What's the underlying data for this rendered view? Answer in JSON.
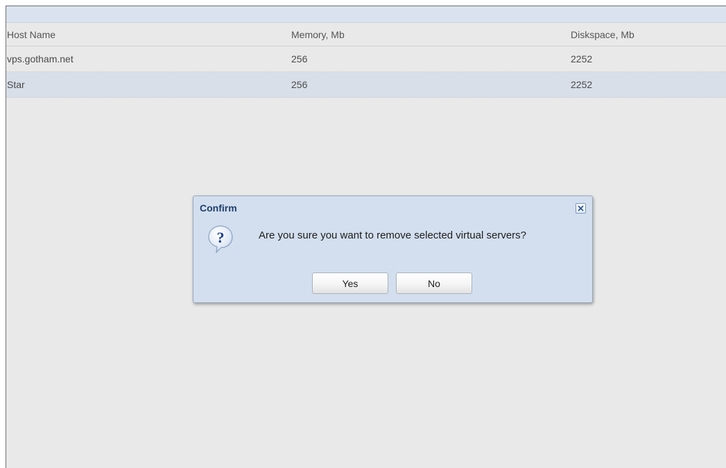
{
  "table": {
    "columns": [
      "Host Name",
      "Memory, Mb",
      "Diskspace, Mb"
    ],
    "rows": [
      {
        "host": "vps.gotham.net",
        "memory": "256",
        "disk": "2252",
        "selected": false
      },
      {
        "host": "Star",
        "memory": "256",
        "disk": "2252",
        "selected": true
      }
    ]
  },
  "dialog": {
    "title": "Confirm",
    "message": "Are you sure you want to remove selected virtual servers?",
    "icon": "question-icon",
    "close_icon": "close-icon",
    "yes_label": "Yes",
    "no_label": "No"
  },
  "colors": {
    "background": "#e9e9e9",
    "selected_row": "#d8dfe9",
    "dialog_bg": "#d3dfee",
    "title_text": "#1f3f6d",
    "icon_blue": "#1a3f8f"
  }
}
